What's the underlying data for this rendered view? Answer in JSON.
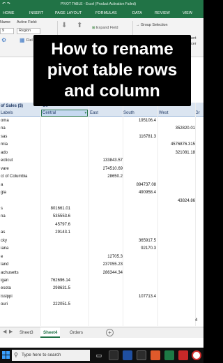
{
  "titlebar": {
    "quick_access": "↶ ↷",
    "title": "PIVOT TABLE - Excel (Product Activation Failed)"
  },
  "ribbon_tabs": [
    "HOME",
    "INSERT",
    "PAGE LAYOUT",
    "FORMULAS",
    "DATA",
    "REVIEW",
    "VIEW"
  ],
  "ribbon": {
    "name_label": "Name:",
    "active_field_label": "Active Field:",
    "active_field_value": "Region",
    "name_value": "9",
    "field_settings": "Fiel",
    "expand_field": "Expand Field",
    "group_selection": "Group Selection",
    "insert": "Insert",
    "slicer": "Slicer"
  },
  "caption": {
    "line1": "How to rename",
    "line2": "pivot table rows",
    "line3": "and column"
  },
  "pivot": {
    "title_left": "of Sales ($)",
    "title_right": "Co",
    "row_labels": "Labels",
    "columns": [
      "Central",
      "East",
      "South",
      "West",
      "Gr"
    ]
  },
  "rows": [
    {
      "label": "oma",
      "central": "",
      "east": "",
      "south": "195106.4",
      "west": ""
    },
    {
      "label": "na",
      "central": "",
      "east": "",
      "south": "",
      "west": "352820.01"
    },
    {
      "label": "sas",
      "central": "",
      "east": "",
      "south": "116781.3",
      "west": ""
    },
    {
      "label": "rnia",
      "central": "",
      "east": "",
      "south": "",
      "west": "4576876.315"
    },
    {
      "label": "ado",
      "central": "",
      "east": "",
      "south": "",
      "west": "321081.18"
    },
    {
      "label": "ecticut",
      "central": "",
      "east": "133843.57",
      "south": "",
      "west": ""
    },
    {
      "label": "vare",
      "central": "",
      "east": "274510.69",
      "south": "",
      "west": ""
    },
    {
      "label": "ct of Columbia",
      "central": "",
      "east": "28650.2",
      "south": "",
      "west": ""
    },
    {
      "label": "a",
      "central": "",
      "east": "",
      "south": "894737.08",
      "west": ""
    },
    {
      "label": "gia",
      "central": "",
      "east": "",
      "south": "490958.4",
      "west": ""
    },
    {
      "label": "",
      "central": "",
      "east": "",
      "south": "",
      "west": "43824.86"
    },
    {
      "label": "s",
      "central": "801661.01",
      "east": "",
      "south": "",
      "west": ""
    },
    {
      "label": "na",
      "central": "535553.6",
      "east": "",
      "south": "",
      "west": ""
    },
    {
      "label": "",
      "central": "45797.6",
      "east": "",
      "south": "",
      "west": ""
    },
    {
      "label": "as",
      "central": "29143.1",
      "east": "",
      "south": "",
      "west": ""
    },
    {
      "label": "cky",
      "central": "",
      "east": "",
      "south": "365917.5",
      "west": ""
    },
    {
      "label": "iana",
      "central": "",
      "east": "",
      "south": "92170.3",
      "west": ""
    },
    {
      "label": "e",
      "central": "",
      "east": "12705.3",
      "south": "",
      "west": ""
    },
    {
      "label": "land",
      "central": "",
      "east": "237055.23",
      "south": "",
      "west": ""
    },
    {
      "label": "achusetts",
      "central": "",
      "east": "286344.34",
      "south": "",
      "west": ""
    },
    {
      "label": "igan",
      "central": "762696.14",
      "east": "",
      "south": "",
      "west": ""
    },
    {
      "label": "esota",
      "central": "298631.5",
      "east": "",
      "south": "",
      "west": ""
    },
    {
      "label": "issippi",
      "central": "",
      "east": "",
      "south": "107713.4",
      "west": ""
    },
    {
      "label": "ouri",
      "central": "222051.5",
      "east": "",
      "south": "",
      "west": ""
    }
  ],
  "extra_col_value": "4",
  "sheet_tabs": [
    "Sheet3",
    "Sheet4",
    "Orders"
  ],
  "active_sheet": "Sheet4",
  "taskbar": {
    "search_placeholder": "Type here to search"
  }
}
